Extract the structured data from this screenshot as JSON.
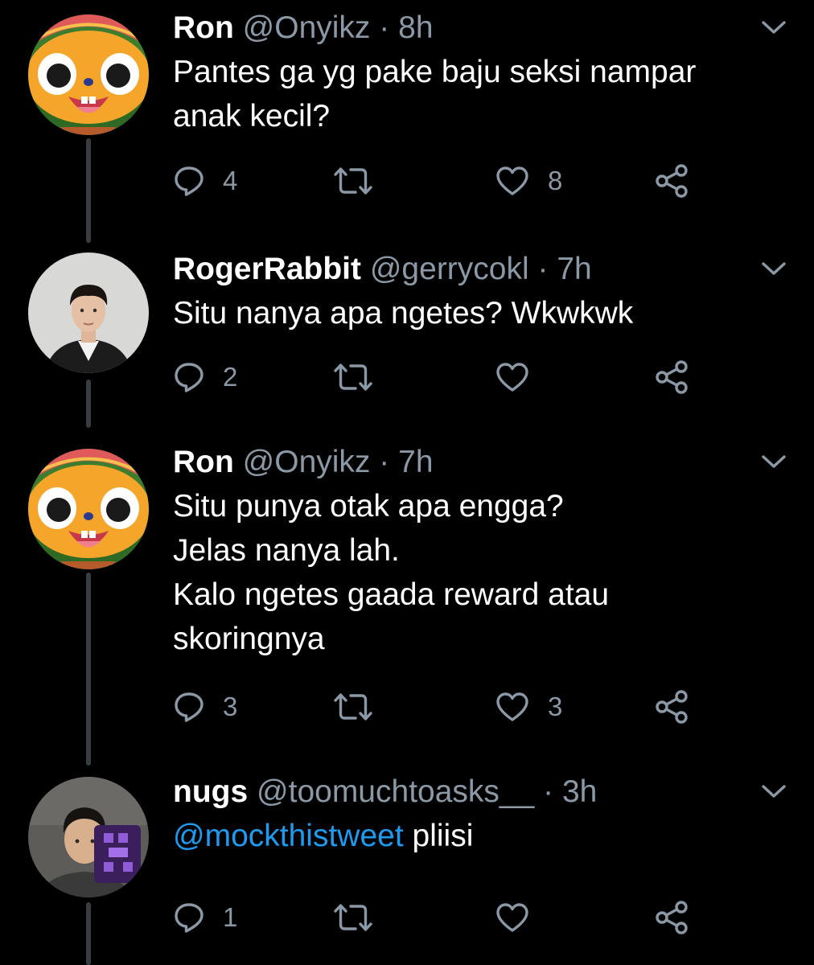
{
  "tweets": [
    {
      "name": "Ron",
      "handle": "@Onyikz",
      "time": "8h",
      "lines": [
        "Pantes ga yg pake baju seksi nampar",
        "anak kecil?"
      ],
      "reply_count": "4",
      "like_count": "8",
      "avatar": "hamster-cartoon-avatar"
    },
    {
      "name": "RogerRabbit",
      "handle": "@gerrycokl",
      "time": "7h",
      "lines": [
        "Situ nanya apa ngetes? Wkwkwk"
      ],
      "reply_count": "2",
      "like_count": "",
      "avatar": "man-photo-avatar"
    },
    {
      "name": "Ron",
      "handle": "@Onyikz",
      "time": "7h",
      "lines": [
        "Situ punya otak apa engga?",
        "Jelas nanya lah.",
        "Kalo ngetes gaada reward atau",
        "skoringnya"
      ],
      "reply_count": "3",
      "like_count": "3",
      "avatar": "hamster-cartoon-avatar"
    },
    {
      "name": "nugs",
      "handle": "@toomuchtoasks__",
      "time": "3h",
      "mention": "@mockthistweet",
      "text_after_mention": " pliisi",
      "reply_count": "1",
      "like_count": "",
      "avatar": "man-photo-sticker-avatar"
    }
  ],
  "separator": "·",
  "colors": {
    "background": "#000000",
    "secondary_text": "#8b98a5",
    "link": "#1d9bf0"
  }
}
